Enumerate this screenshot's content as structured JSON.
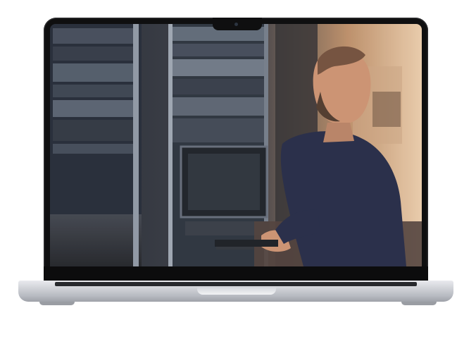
{
  "image": {
    "subject": "laptop-mockup",
    "screen_scene": "server-room",
    "colors": {
      "bezel": "#0f0f10",
      "chassis": "#c7cad0",
      "rack": "#2b313b",
      "warm_light": "#d9a77a",
      "shirt": "#1e2440",
      "skin": "#c98e6c"
    }
  }
}
